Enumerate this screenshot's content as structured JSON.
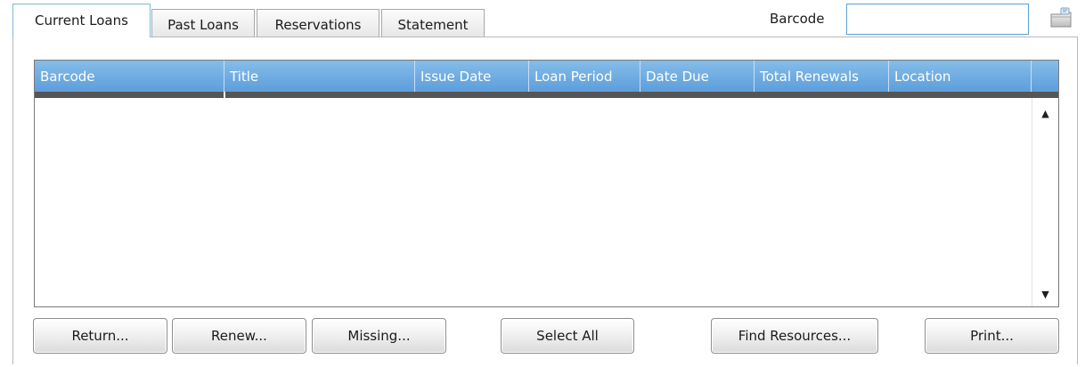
{
  "tabs": [
    {
      "label": "Current Loans",
      "active": true
    },
    {
      "label": "Past Loans",
      "active": false
    },
    {
      "label": "Reservations",
      "active": false
    },
    {
      "label": "Statement",
      "active": false
    }
  ],
  "search": {
    "label": "Barcode",
    "value": "",
    "icon": "lookup-icon"
  },
  "grid": {
    "columns": [
      "Barcode",
      "Title",
      "Issue Date",
      "Loan Period",
      "Date Due",
      "Total Renewals",
      "Location"
    ],
    "rows": []
  },
  "scrollbar": {
    "up": "▲",
    "down": "▼"
  },
  "buttons": {
    "return": "Return...",
    "renew": "Renew...",
    "missing": "Missing...",
    "select_all": "Select All",
    "find_resources": "Find Resources...",
    "print": "Print..."
  },
  "colors": {
    "header_blue": "#5c9ddb",
    "active_tab_border": "#7fb8da",
    "input_border": "#5aa0d6"
  }
}
